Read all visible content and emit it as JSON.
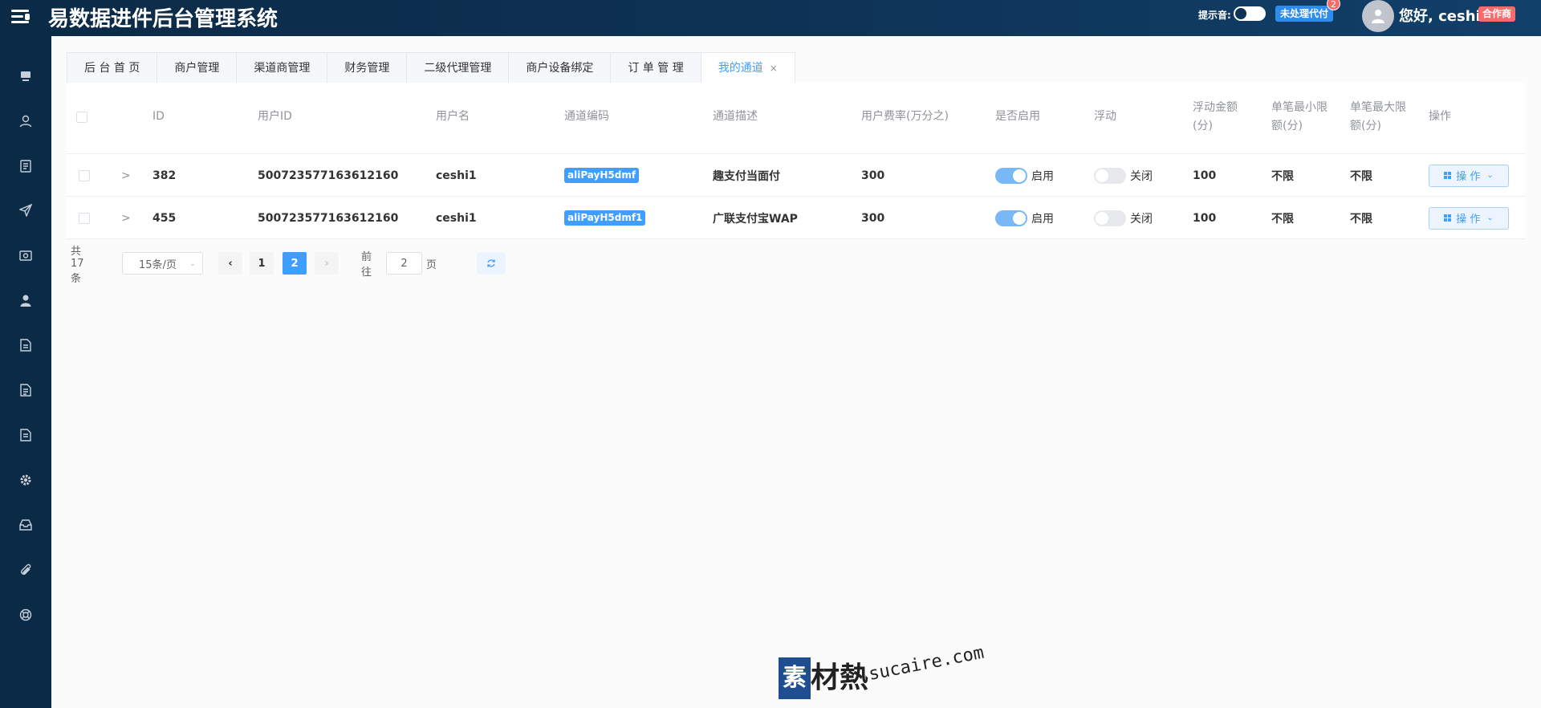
{
  "header": {
    "app_title": "易数据进件后台管理系统",
    "sound_label": "提示音:",
    "pending_button": "未处理代付",
    "pending_count": "2",
    "greeting": "您好, ceshi1",
    "role_tag": "合作商"
  },
  "sidebar": {
    "items": [
      {
        "icon": "monitor-icon"
      },
      {
        "icon": "user-icon"
      },
      {
        "icon": "document-icon"
      },
      {
        "icon": "send-icon"
      },
      {
        "icon": "wallet-icon"
      },
      {
        "icon": "person-icon"
      },
      {
        "icon": "file-icon"
      },
      {
        "icon": "file-text-icon"
      },
      {
        "icon": "file-list-icon"
      },
      {
        "icon": "gear-icon"
      },
      {
        "icon": "inbox-icon"
      },
      {
        "icon": "paperclip-icon"
      },
      {
        "icon": "lifebuoy-icon"
      }
    ]
  },
  "tabs": [
    {
      "label": "后 台 首 页"
    },
    {
      "label": "商户管理"
    },
    {
      "label": "渠道商管理"
    },
    {
      "label": "财务管理"
    },
    {
      "label": "二级代理管理"
    },
    {
      "label": "商户设备绑定"
    },
    {
      "label": "订 单 管 理"
    },
    {
      "label": "我的通道",
      "active": true,
      "close": "×"
    }
  ],
  "table": {
    "headers": {
      "id": "ID",
      "user_id": "用户ID",
      "username": "用户名",
      "channel_code": "通道编码",
      "channel_desc": "通道描述",
      "user_rate": "用户费率(万分之)",
      "enabled": "是否启用",
      "float": "浮动",
      "float_amount_1": "浮动金额",
      "float_amount_2": "(分)",
      "min_limit_1": "单笔最小限",
      "min_limit_2": "额(分)",
      "max_limit_1": "单笔最大限",
      "max_limit_2": "额(分)",
      "actions": "操作"
    },
    "rows": [
      {
        "id": "382",
        "user_id": "500723577163612160",
        "username": "ceshi1",
        "channel_code": "aliPayH5dmf",
        "channel_desc": "趣支付当面付",
        "user_rate": "300",
        "enabled_label": "启用",
        "float_label": "关闭",
        "float_amount": "100",
        "min_limit": "不限",
        "max_limit": "不限",
        "action_label": "操 作"
      },
      {
        "id": "455",
        "user_id": "500723577163612160",
        "username": "ceshi1",
        "channel_code": "aliPayH5dmf1",
        "channel_desc": "广联支付宝WAP",
        "user_rate": "300",
        "enabled_label": "启用",
        "float_label": "关闭",
        "float_amount": "100",
        "min_limit": "不限",
        "max_limit": "不限",
        "action_label": "操 作"
      }
    ]
  },
  "pagination": {
    "total": "共 17 条",
    "page_size": "15条/页",
    "pages": [
      "1",
      "2"
    ],
    "current_page": "2",
    "goto_prefix": "前往",
    "goto_value": "2",
    "goto_suffix": "页"
  },
  "watermark": {
    "mark": "素",
    "text": "材熱",
    "domain": "sucaire.com"
  },
  "colors": {
    "header_bg": "#0e3356",
    "sidebar_bg": "#0b2a46",
    "accent": "#409eff",
    "danger": "#f56c6c"
  }
}
